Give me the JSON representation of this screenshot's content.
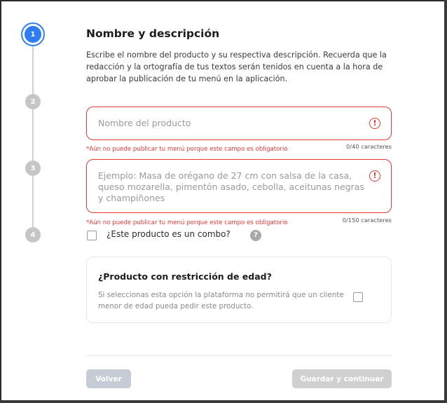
{
  "stepper": {
    "steps": [
      "1",
      "2",
      "3",
      "4"
    ],
    "active_index": 0,
    "accent_color": "#2f7df6"
  },
  "section": {
    "title": "Nombre y descripción",
    "description": "Escribe el nombre del producto y su respectiva descripción. Recuerda que la redacción y la ortografía de tus textos serán tenidos en cuenta a la hora de aprobar la publicación de tu menú en la aplicación."
  },
  "product_name": {
    "placeholder": "Nombre del producto",
    "error": "*Aún no puede publicar tu menú porque este campo es obligatorio",
    "counter": "0/40 caracteres"
  },
  "product_description": {
    "placeholder": "Ejemplo: Masa de orégano de 27 cm con salsa de la casa, queso mozarella, pimentón asado, cebolla, aceitunas negras y champiñones",
    "error": "*Aún no puede publicar tu menú porque este campo es obligatorio",
    "counter": "0/150 caracteres"
  },
  "combo": {
    "label": "¿Este producto es un combo?",
    "help_icon": "?",
    "checked": false
  },
  "age_restriction": {
    "title": "¿Producto con restricción de edad?",
    "description": "Si seleccionas esta opción la plataforma no permitirá que un cliente menor de edad pueda pedir este producto.",
    "checked": false
  },
  "actions": {
    "back_label": "Volver",
    "save_label": "Guardar y continuar"
  },
  "colors": {
    "error": "#e53935",
    "disabled_button": "#d0d0d0"
  }
}
